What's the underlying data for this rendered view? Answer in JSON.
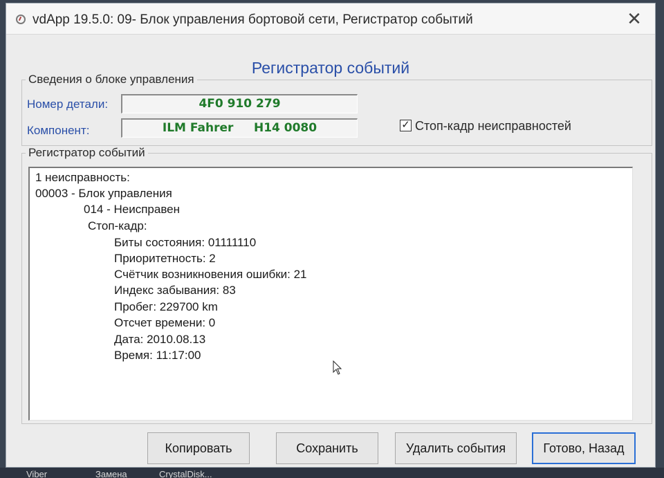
{
  "window": {
    "title": "vdApp 19.5.0: 09- Блок управления бортовой сети,  Регистратор событий",
    "close_glyph": "✕"
  },
  "heading": "Регистратор событий",
  "control_unit": {
    "group_label": "Сведения о блоке управления",
    "part_number_label": "Номер детали:",
    "part_number_value": "4F0 910 279",
    "component_label": "Компонент:",
    "component_value": "ILM Fahrer     H14 0080"
  },
  "freeze_frame_checkbox": {
    "label": "Стоп-кадр неисправностей",
    "checked": true,
    "check_glyph": "✓"
  },
  "event_log": {
    "group_label": "Регистратор событий",
    "lines": [
      "1 неисправность:",
      "00003 - Блок управления",
      "014 - Неисправен",
      "Стоп-кадр:",
      "Биты состояния: 01111110",
      "Приоритетность: 2",
      "Счётчик возникновения ошибки: 21",
      "Индекс забывания: 83",
      "Пробег: 229700 km",
      "Отсчет времени: 0",
      "Дата: 2010.08.13",
      "Время: 11:17:00"
    ]
  },
  "buttons": {
    "copy": "Копировать",
    "save": "Сохранить",
    "delete_events": "Удалить события",
    "done_back": "Готово, Назад"
  },
  "taskbar": {
    "items": [
      "Viber",
      "Замена",
      "CrystalDisk..."
    ]
  },
  "colors": {
    "accent_blue": "#2a4fa8",
    "value_green": "#1f7a2a",
    "default_button_border": "#2a6fd6"
  }
}
